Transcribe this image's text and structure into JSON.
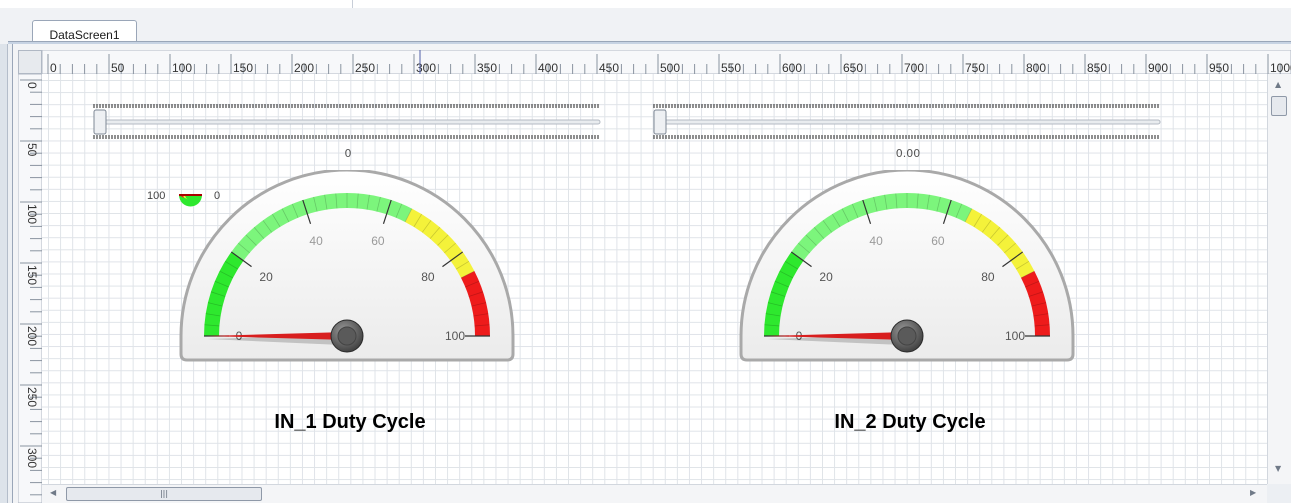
{
  "tab": {
    "label": "DataScreen1"
  },
  "ruler": {
    "x_labels": [
      "0",
      "50",
      "100",
      "150",
      "200",
      "250",
      "300",
      "350",
      "400",
      "450",
      "500",
      "550",
      "600",
      "650",
      "700",
      "750",
      "800",
      "850",
      "900",
      "950",
      "1000"
    ],
    "y_labels": [
      "0",
      "50",
      "100",
      "150",
      "200",
      "250",
      "300"
    ]
  },
  "sliders": [
    {
      "value_label": "0",
      "position": 0.0
    },
    {
      "value_label": "0.00",
      "position": 0.0
    }
  ],
  "mini_gauge": {
    "left_label": "100",
    "right_label": "0"
  },
  "gauges": [
    {
      "title": "IN_1 Duty Cycle",
      "value": 0,
      "scale_min": 0,
      "scale_max": 100,
      "scale_labels": [
        "0",
        "20",
        "40",
        "60",
        "80",
        "100"
      ],
      "bands": [
        {
          "from": 0,
          "to": 20,
          "color": "#2ee82e"
        },
        {
          "from": 20,
          "to": 65,
          "color": "#7cf57c"
        },
        {
          "from": 65,
          "to": 85,
          "color": "#f4f23a"
        },
        {
          "from": 85,
          "to": 100,
          "color": "#ee1b1b"
        }
      ]
    },
    {
      "title": "IN_2 Duty Cycle",
      "value": 0,
      "scale_min": 0,
      "scale_max": 100,
      "scale_labels": [
        "0",
        "20",
        "40",
        "60",
        "80",
        "100"
      ],
      "bands": [
        {
          "from": 0,
          "to": 20,
          "color": "#2ee82e"
        },
        {
          "from": 20,
          "to": 65,
          "color": "#7cf57c"
        },
        {
          "from": 65,
          "to": 85,
          "color": "#f4f23a"
        },
        {
          "from": 85,
          "to": 100,
          "color": "#ee1b1b"
        }
      ]
    }
  ],
  "colors": {
    "needle": "#d81e1e",
    "grid": "#dfe3e8",
    "bezel": "#a9a9a9"
  }
}
